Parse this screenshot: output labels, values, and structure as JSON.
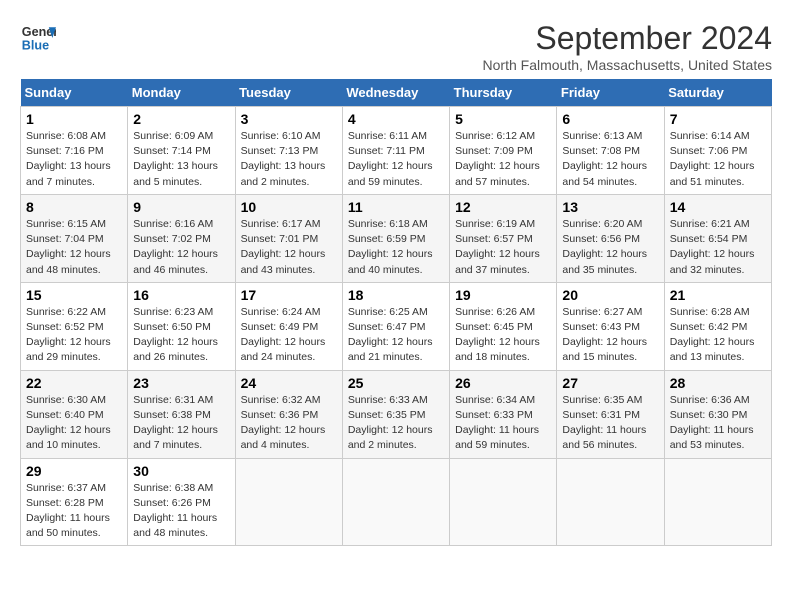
{
  "logo": {
    "line1": "General",
    "line2": "Blue"
  },
  "title": "September 2024",
  "subtitle": "North Falmouth, Massachusetts, United States",
  "days_header": [
    "Sunday",
    "Monday",
    "Tuesday",
    "Wednesday",
    "Thursday",
    "Friday",
    "Saturday"
  ],
  "weeks": [
    [
      {
        "day": "1",
        "sunrise": "Sunrise: 6:08 AM",
        "sunset": "Sunset: 7:16 PM",
        "daylight": "Daylight: 13 hours and 7 minutes."
      },
      {
        "day": "2",
        "sunrise": "Sunrise: 6:09 AM",
        "sunset": "Sunset: 7:14 PM",
        "daylight": "Daylight: 13 hours and 5 minutes."
      },
      {
        "day": "3",
        "sunrise": "Sunrise: 6:10 AM",
        "sunset": "Sunset: 7:13 PM",
        "daylight": "Daylight: 13 hours and 2 minutes."
      },
      {
        "day": "4",
        "sunrise": "Sunrise: 6:11 AM",
        "sunset": "Sunset: 7:11 PM",
        "daylight": "Daylight: 12 hours and 59 minutes."
      },
      {
        "day": "5",
        "sunrise": "Sunrise: 6:12 AM",
        "sunset": "Sunset: 7:09 PM",
        "daylight": "Daylight: 12 hours and 57 minutes."
      },
      {
        "day": "6",
        "sunrise": "Sunrise: 6:13 AM",
        "sunset": "Sunset: 7:08 PM",
        "daylight": "Daylight: 12 hours and 54 minutes."
      },
      {
        "day": "7",
        "sunrise": "Sunrise: 6:14 AM",
        "sunset": "Sunset: 7:06 PM",
        "daylight": "Daylight: 12 hours and 51 minutes."
      }
    ],
    [
      {
        "day": "8",
        "sunrise": "Sunrise: 6:15 AM",
        "sunset": "Sunset: 7:04 PM",
        "daylight": "Daylight: 12 hours and 48 minutes."
      },
      {
        "day": "9",
        "sunrise": "Sunrise: 6:16 AM",
        "sunset": "Sunset: 7:02 PM",
        "daylight": "Daylight: 12 hours and 46 minutes."
      },
      {
        "day": "10",
        "sunrise": "Sunrise: 6:17 AM",
        "sunset": "Sunset: 7:01 PM",
        "daylight": "Daylight: 12 hours and 43 minutes."
      },
      {
        "day": "11",
        "sunrise": "Sunrise: 6:18 AM",
        "sunset": "Sunset: 6:59 PM",
        "daylight": "Daylight: 12 hours and 40 minutes."
      },
      {
        "day": "12",
        "sunrise": "Sunrise: 6:19 AM",
        "sunset": "Sunset: 6:57 PM",
        "daylight": "Daylight: 12 hours and 37 minutes."
      },
      {
        "day": "13",
        "sunrise": "Sunrise: 6:20 AM",
        "sunset": "Sunset: 6:56 PM",
        "daylight": "Daylight: 12 hours and 35 minutes."
      },
      {
        "day": "14",
        "sunrise": "Sunrise: 6:21 AM",
        "sunset": "Sunset: 6:54 PM",
        "daylight": "Daylight: 12 hours and 32 minutes."
      }
    ],
    [
      {
        "day": "15",
        "sunrise": "Sunrise: 6:22 AM",
        "sunset": "Sunset: 6:52 PM",
        "daylight": "Daylight: 12 hours and 29 minutes."
      },
      {
        "day": "16",
        "sunrise": "Sunrise: 6:23 AM",
        "sunset": "Sunset: 6:50 PM",
        "daylight": "Daylight: 12 hours and 26 minutes."
      },
      {
        "day": "17",
        "sunrise": "Sunrise: 6:24 AM",
        "sunset": "Sunset: 6:49 PM",
        "daylight": "Daylight: 12 hours and 24 minutes."
      },
      {
        "day": "18",
        "sunrise": "Sunrise: 6:25 AM",
        "sunset": "Sunset: 6:47 PM",
        "daylight": "Daylight: 12 hours and 21 minutes."
      },
      {
        "day": "19",
        "sunrise": "Sunrise: 6:26 AM",
        "sunset": "Sunset: 6:45 PM",
        "daylight": "Daylight: 12 hours and 18 minutes."
      },
      {
        "day": "20",
        "sunrise": "Sunrise: 6:27 AM",
        "sunset": "Sunset: 6:43 PM",
        "daylight": "Daylight: 12 hours and 15 minutes."
      },
      {
        "day": "21",
        "sunrise": "Sunrise: 6:28 AM",
        "sunset": "Sunset: 6:42 PM",
        "daylight": "Daylight: 12 hours and 13 minutes."
      }
    ],
    [
      {
        "day": "22",
        "sunrise": "Sunrise: 6:30 AM",
        "sunset": "Sunset: 6:40 PM",
        "daylight": "Daylight: 12 hours and 10 minutes."
      },
      {
        "day": "23",
        "sunrise": "Sunrise: 6:31 AM",
        "sunset": "Sunset: 6:38 PM",
        "daylight": "Daylight: 12 hours and 7 minutes."
      },
      {
        "day": "24",
        "sunrise": "Sunrise: 6:32 AM",
        "sunset": "Sunset: 6:36 PM",
        "daylight": "Daylight: 12 hours and 4 minutes."
      },
      {
        "day": "25",
        "sunrise": "Sunrise: 6:33 AM",
        "sunset": "Sunset: 6:35 PM",
        "daylight": "Daylight: 12 hours and 2 minutes."
      },
      {
        "day": "26",
        "sunrise": "Sunrise: 6:34 AM",
        "sunset": "Sunset: 6:33 PM",
        "daylight": "Daylight: 11 hours and 59 minutes."
      },
      {
        "day": "27",
        "sunrise": "Sunrise: 6:35 AM",
        "sunset": "Sunset: 6:31 PM",
        "daylight": "Daylight: 11 hours and 56 minutes."
      },
      {
        "day": "28",
        "sunrise": "Sunrise: 6:36 AM",
        "sunset": "Sunset: 6:30 PM",
        "daylight": "Daylight: 11 hours and 53 minutes."
      }
    ],
    [
      {
        "day": "29",
        "sunrise": "Sunrise: 6:37 AM",
        "sunset": "Sunset: 6:28 PM",
        "daylight": "Daylight: 11 hours and 50 minutes."
      },
      {
        "day": "30",
        "sunrise": "Sunrise: 6:38 AM",
        "sunset": "Sunset: 6:26 PM",
        "daylight": "Daylight: 11 hours and 48 minutes."
      },
      null,
      null,
      null,
      null,
      null
    ]
  ]
}
